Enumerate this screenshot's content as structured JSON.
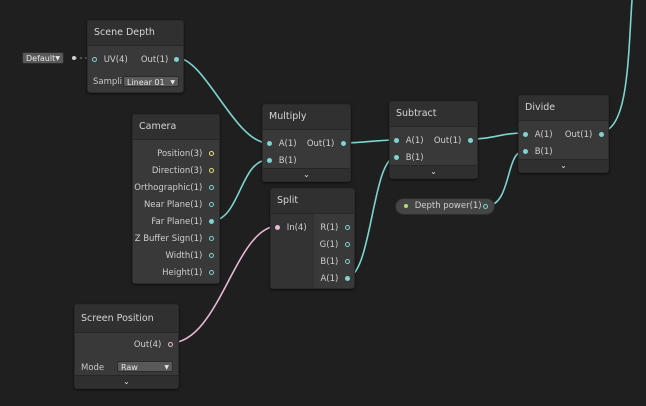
{
  "nodes": {
    "scene_depth": {
      "title": "Scene Depth",
      "in_uv": "UV(4)",
      "out": "Out(1)",
      "sampling_label": "Sampli",
      "sampling_value": "Linear 01",
      "default_value": "Default"
    },
    "camera": {
      "title": "Camera",
      "outputs": [
        "Position(3)",
        "Direction(3)",
        "Orthographic(1)",
        "Near Plane(1)",
        "Far Plane(1)",
        "Z Buffer Sign(1)",
        "Width(1)",
        "Height(1)"
      ]
    },
    "multiply": {
      "title": "Multiply",
      "in_a": "A(1)",
      "in_b": "B(1)",
      "out": "Out(1)"
    },
    "subtract": {
      "title": "Subtract",
      "in_a": "A(1)",
      "in_b": "B(1)",
      "out": "Out(1)"
    },
    "divide": {
      "title": "Divide",
      "in_a": "A(1)",
      "in_b": "B(1)",
      "out": "Out(1)"
    },
    "split": {
      "title": "Split",
      "in": "In(4)",
      "outputs": [
        "R(1)",
        "G(1)",
        "B(1)",
        "A(1)"
      ]
    },
    "depth_power": {
      "label": "Depth power(1)"
    },
    "screen_position": {
      "title": "Screen Position",
      "out": "Out(4)",
      "mode_label": "Mode",
      "mode_value": "Raw"
    }
  },
  "colors": {
    "background": "#1f1f1f",
    "node_body": "#393939",
    "wire_float": "#7ed4d1",
    "wire_vector4": "#e9b8d4"
  },
  "icons": {
    "expand": "chevron-down-icon",
    "dropdown": "triangle-down-icon"
  }
}
